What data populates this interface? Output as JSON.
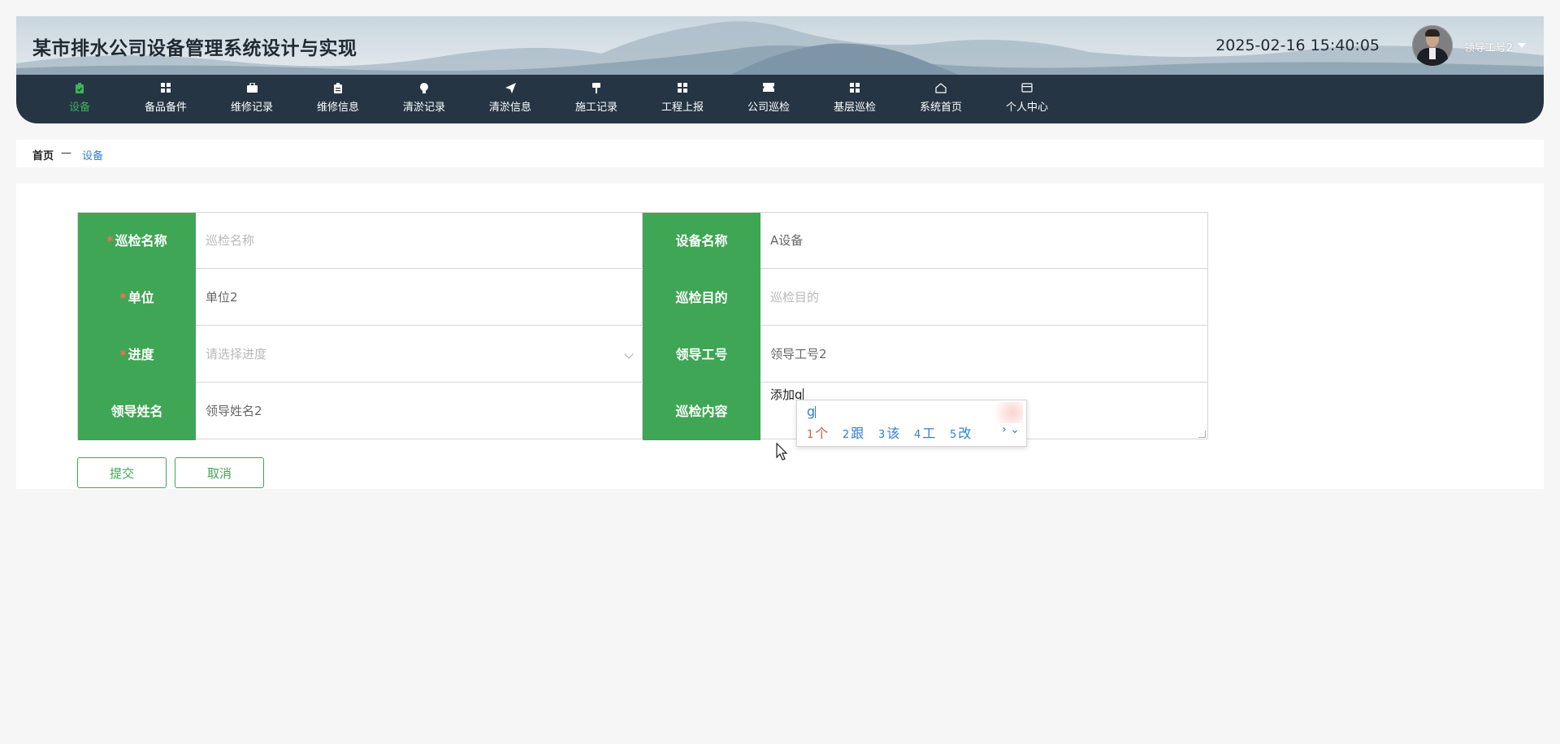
{
  "app": {
    "title": "某市排水公司设备管理系统设计与实现",
    "datetime": "2025-02-16 15:40:05",
    "user_name": "领导工号2"
  },
  "nav": {
    "items": [
      {
        "label": "设备",
        "icon": "clipboard-icon",
        "active": true
      },
      {
        "label": "备品备件",
        "icon": "grid-icon",
        "active": false
      },
      {
        "label": "维修记录",
        "icon": "briefcase-icon",
        "active": false
      },
      {
        "label": "维修信息",
        "icon": "clipboard-icon",
        "active": false
      },
      {
        "label": "清淤记录",
        "icon": "lightbulb-icon",
        "active": false
      },
      {
        "label": "清淤信息",
        "icon": "send-icon",
        "active": false
      },
      {
        "label": "施工记录",
        "icon": "hammer-icon",
        "active": false
      },
      {
        "label": "工程上报",
        "icon": "grid-icon",
        "active": false
      },
      {
        "label": "公司巡检",
        "icon": "ticket-icon",
        "active": false
      },
      {
        "label": "基层巡检",
        "icon": "grid-icon",
        "active": false
      },
      {
        "label": "系统首页",
        "icon": "home-icon",
        "active": false
      },
      {
        "label": "个人中心",
        "icon": "card-icon",
        "active": false
      }
    ]
  },
  "breadcrumb": {
    "home": "首页",
    "separator": "—",
    "current": "设备"
  },
  "form": {
    "patrol_name": {
      "label": "巡检名称",
      "value": "",
      "placeholder": "巡检名称",
      "required": true
    },
    "device_name": {
      "label": "设备名称",
      "value": "A设备"
    },
    "unit": {
      "label": "单位",
      "value": "单位2",
      "required": true
    },
    "patrol_purpose": {
      "label": "巡检目的",
      "value": "",
      "placeholder": "巡检目的"
    },
    "progress": {
      "label": "进度",
      "value": "",
      "placeholder": "请选择进度",
      "required": true
    },
    "leader_id": {
      "label": "领导工号",
      "value": "领导工号2"
    },
    "leader_name": {
      "label": "领导姓名",
      "value": "领导姓名2"
    },
    "patrol_content": {
      "label": "巡检内容",
      "value": "添加g"
    },
    "required_mark": "*"
  },
  "buttons": {
    "submit": "提交",
    "cancel": "取消"
  },
  "ime": {
    "composition": "g",
    "candidates": [
      {
        "num": "1",
        "text": "个"
      },
      {
        "num": "2",
        "text": "跟"
      },
      {
        "num": "3",
        "text": "该"
      },
      {
        "num": "4",
        "text": "工"
      },
      {
        "num": "5",
        "text": "改"
      }
    ],
    "more": "› ⌄"
  },
  "colors": {
    "nav_bg": "#263544",
    "accent_green": "#3ea654",
    "active_nav": "#3cb45a",
    "link_blue": "#2f7fcf",
    "required_red": "#ff6b5b"
  }
}
